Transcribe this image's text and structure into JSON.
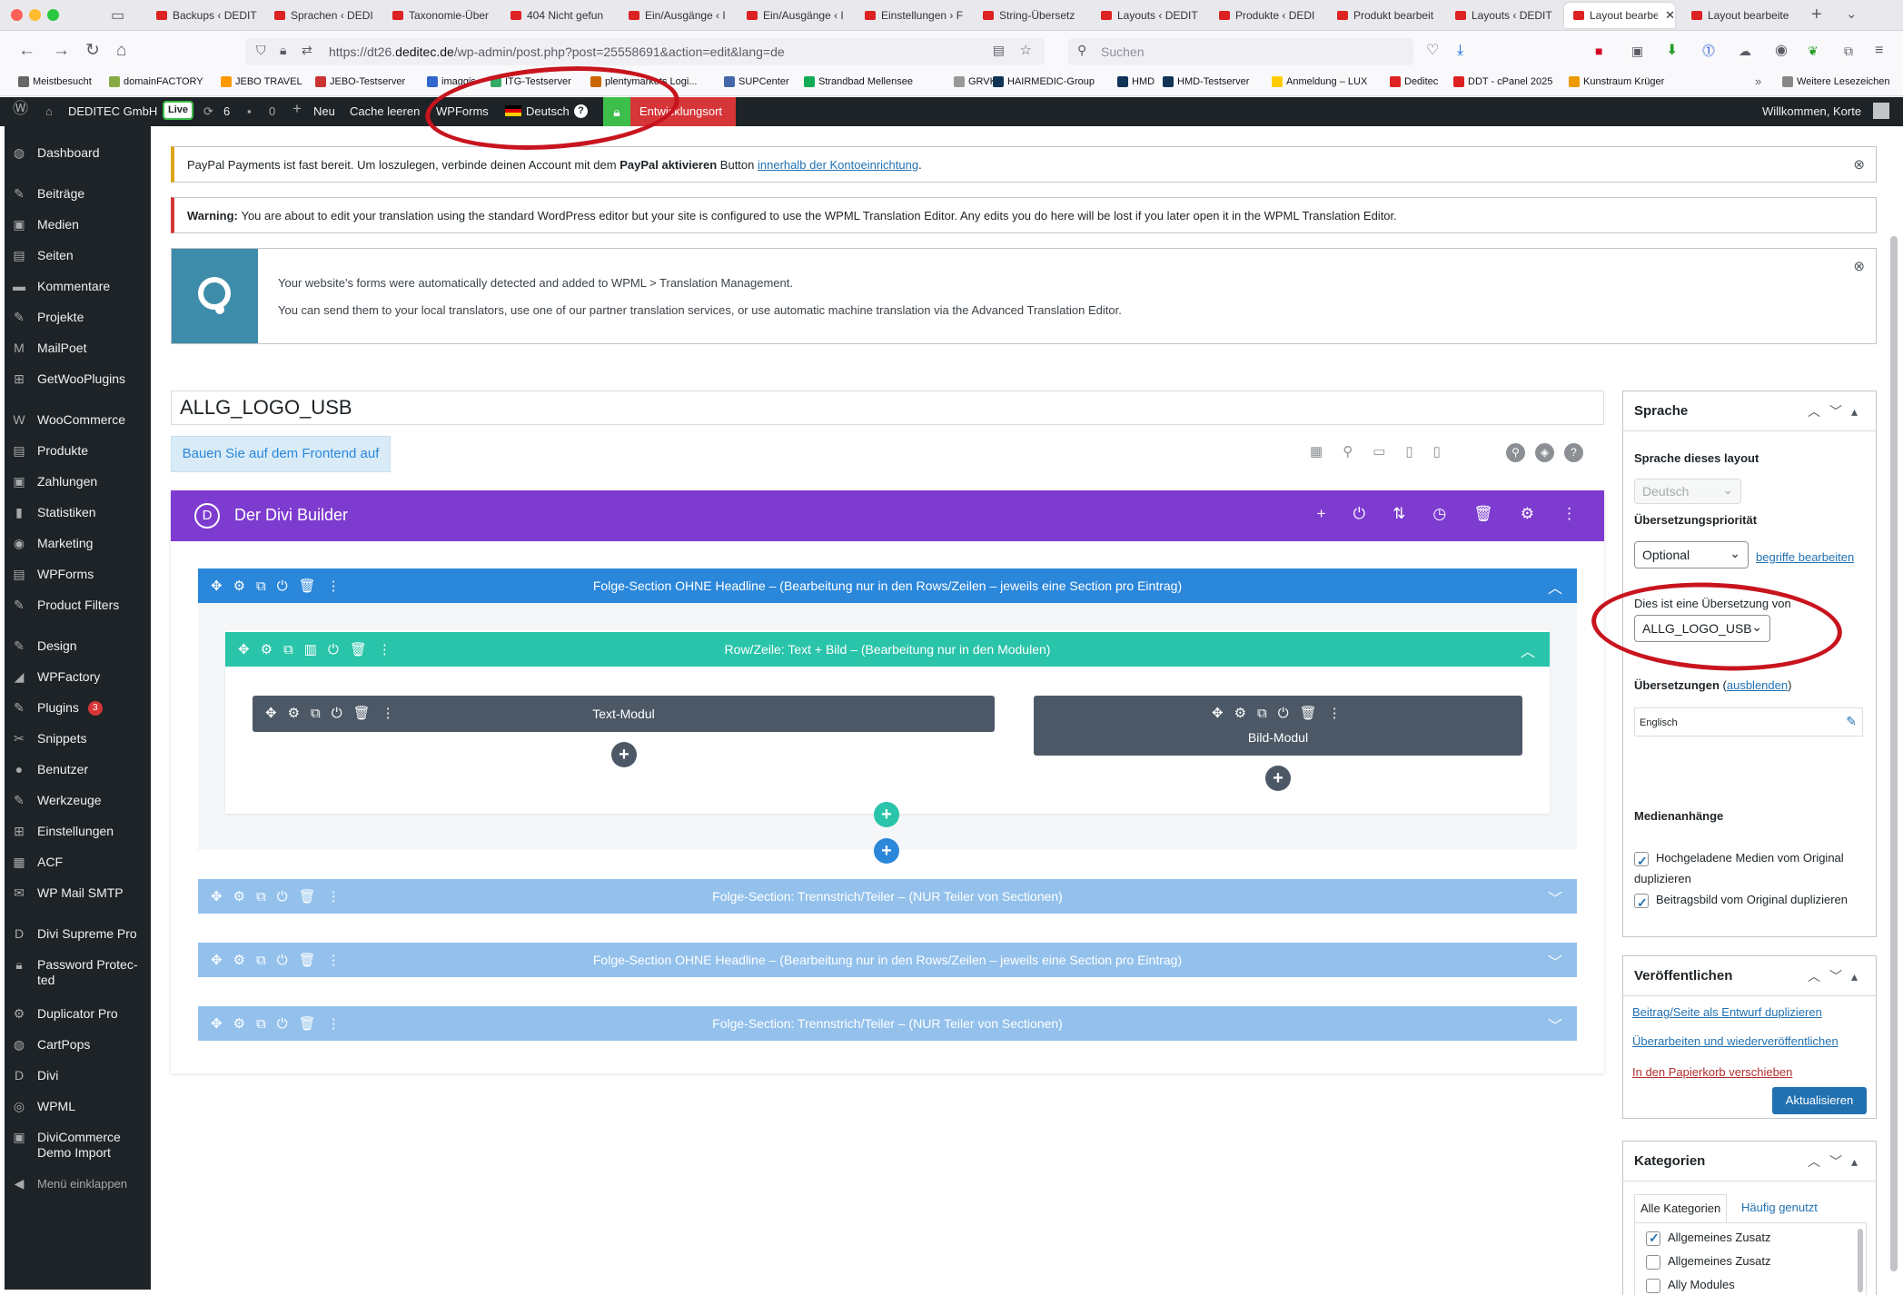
{
  "browser": {
    "tabs": [
      "Backups ‹ DEDIT",
      "Sprachen ‹ DEDI",
      "Taxonomie-Über",
      "404 Nicht gefun",
      "Ein/Ausgänge ‹ I",
      "Ein/Ausgänge ‹ I",
      "Einstellungen › F",
      "String-Übersetz",
      "Layouts ‹ DEDIT",
      "Produkte ‹ DEDI",
      "Produkt bearbeit",
      "Layouts ‹ DEDIT",
      "Layout bearbe",
      "Layout bearbeite"
    ],
    "active_tab_index": 12,
    "url_prefix": "https://dt26.",
    "url_host": "deditec.de",
    "url_rest": "/wp-admin/post.php?post=25558691&action=edit&lang=de",
    "search_placeholder": "Suchen",
    "bookmarks": [
      "Meistbesucht",
      "domainFACTORY",
      "JEBO TRAVEL",
      "JEBO-Testserver",
      "imaggis",
      "ITG-Testserver",
      "plentymarkets Logi...",
      "SUPCenter",
      "Strandbad Mellensee",
      "GRVK",
      "HAIRMEDIC-Group",
      "HMD",
      "HMD-Testserver",
      "Anmeldung – LUX",
      "Deditec",
      "DDT - cPanel 2025",
      "Kunstraum Krüger",
      "Weitere Lesezeichen"
    ]
  },
  "adminbar": {
    "site": "DEDITEC GmbH",
    "live": "Live",
    "updates": "6",
    "comments": "0",
    "new": "Neu",
    "cache": "Cache leeren",
    "wpforms": "WPForms",
    "language": "Deutsch",
    "env": "Entwicklungsort",
    "welcome": "Willkommen, Korte"
  },
  "sidebar": {
    "items": [
      "Dashboard",
      "Beiträge",
      "Medien",
      "Seiten",
      "Kommentare",
      "Projekte",
      "MailPoet",
      "GetWooPlugins",
      "WooCommerce",
      "Produkte",
      "Zahlungen",
      "Statistiken",
      "Marketing",
      "WPForms",
      "Product Filters",
      "Design",
      "WPFactory",
      "Plugins",
      "Snippets",
      "Benutzer",
      "Werkzeuge",
      "Einstellungen",
      "ACF",
      "WP Mail SMTP",
      "Divi Supreme Pro",
      "Password Protec-ted",
      "Duplicator Pro",
      "CartPops",
      "Divi",
      "WPML",
      "DiviCommerce Demo Import",
      "Menü einklappen"
    ],
    "plugins_badge": "3"
  },
  "notices": {
    "paypal_pre": "PayPal Payments ist fast bereit. Um loszulegen, verbinde deinen Account mit dem",
    "paypal_bold": "PayPal aktivieren",
    "paypal_mid": "Button",
    "paypal_link": "innerhalb der Kontoeinrichtung",
    "paypal_end": ".",
    "warning_label": "Warning:",
    "warning_text": "You are about to edit your translation using the standard WordPress editor but your site is configured to use the WPML Translation Editor. Any edits you do here will be lost if you later open it in the WPML Translation Editor.",
    "wpml_line1": "Your website's forms were automatically detected and added to WPML > Translation Management.",
    "wpml_line2": "You can send them to your local translators, use one of our partner translation services, or use automatic machine translation via the Advanced Translation Editor."
  },
  "editor": {
    "title": "ALLG_LOGO_USB",
    "frontend_button": "Bauen Sie auf dem Frontend auf",
    "divi_title": "Der Divi Builder",
    "section1": "Folge-Section OHNE Headline – (Bearbeitung nur in den Rows/Zeilen – jeweils eine Section pro Eintrag)",
    "row1": "Row/Zeile: Text + Bild – (Bearbeitung nur in den Modulen)",
    "module_text": "Text-Modul",
    "module_image": "Bild-Modul",
    "section2": "Folge-Section: Trennstrich/Teiler – (NUR Teiler von Sectionen)",
    "section3": "Folge-Section OHNE Headline – (Bearbeitung nur in den Rows/Zeilen – jeweils eine Section pro Eintrag)",
    "section4": "Folge-Section: Trennstrich/Teiler – (NUR Teiler von Sectionen)"
  },
  "language_box": {
    "title": "Sprache",
    "lang_label": "Sprache dieses layout",
    "lang_value": "Deutsch",
    "priority_label": "Übersetzungspriorität",
    "priority_value": "Optional",
    "priority_link": "begriffe bearbeiten",
    "translation_of_label": "Dies ist eine Übersetzung von",
    "translation_of_value": "ALLG_LOGO_USB",
    "translations_label": "Übersetzungen",
    "translations_toggle": "ausblenden",
    "translation_lang": "Englisch",
    "media_label": "Medienanhänge",
    "media_opt1": "Hochgeladene Medien vom Original duplizieren",
    "media_opt2": "Beitragsbild vom Original duplizieren"
  },
  "publish_box": {
    "title": "Veröffentlichen",
    "link1": "Beitrag/Seite als Entwurf duplizieren",
    "link2": "Überarbeiten und wiederveröffentlichen",
    "trash": "In den Papierkorb verschieben",
    "update": "Aktualisieren"
  },
  "categories_box": {
    "title": "Kategorien",
    "tab_all": "Alle Kategorien",
    "tab_popular": "Häufig genutzt",
    "items": [
      {
        "label": "Allgemeines Zusatz",
        "checked": true
      },
      {
        "label": "Allgemeines Zusatz",
        "checked": false
      },
      {
        "label": "Ally Modules",
        "checked": false
      }
    ]
  },
  "colors": {
    "wp_dark": "#1d2327",
    "divi_purple": "#7e3bd0",
    "section_blue": "#2b87da",
    "section_blue_light": "#93c1ec",
    "row_teal": "#29c4a9",
    "module_dark": "#4c5866",
    "annotation_red": "#c8141e",
    "wp_blue": "#2271b1"
  }
}
